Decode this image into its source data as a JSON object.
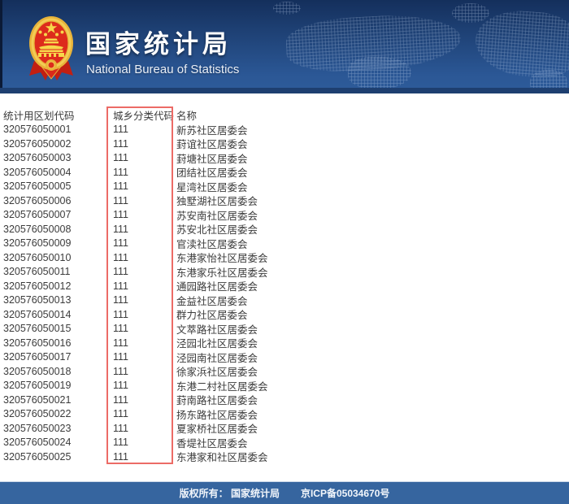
{
  "header": {
    "title": "国家统计局",
    "subtitle": "National Bureau of Statistics"
  },
  "table": {
    "columns": [
      "统计用区划代码",
      "城乡分类代码",
      "名称"
    ],
    "rows": [
      {
        "code": "320576050001",
        "urc": "111",
        "name": "新苏社区居委会"
      },
      {
        "code": "320576050002",
        "urc": "111",
        "name": "葑谊社区居委会"
      },
      {
        "code": "320576050003",
        "urc": "111",
        "name": "葑塘社区居委会"
      },
      {
        "code": "320576050004",
        "urc": "111",
        "name": "团结社区居委会"
      },
      {
        "code": "320576050005",
        "urc": "111",
        "name": "星湾社区居委会"
      },
      {
        "code": "320576050006",
        "urc": "111",
        "name": "独墅湖社区居委会"
      },
      {
        "code": "320576050007",
        "urc": "111",
        "name": "苏安南社区居委会"
      },
      {
        "code": "320576050008",
        "urc": "111",
        "name": "苏安北社区居委会"
      },
      {
        "code": "320576050009",
        "urc": "111",
        "name": "官渎社区居委会"
      },
      {
        "code": "320576050010",
        "urc": "111",
        "name": "东港家怡社区居委会"
      },
      {
        "code": "320576050011",
        "urc": "111",
        "name": "东港家乐社区居委会"
      },
      {
        "code": "320576050012",
        "urc": "111",
        "name": "通园路社区居委会"
      },
      {
        "code": "320576050013",
        "urc": "111",
        "name": "金益社区居委会"
      },
      {
        "code": "320576050014",
        "urc": "111",
        "name": "群力社区居委会"
      },
      {
        "code": "320576050015",
        "urc": "111",
        "name": "文萃路社区居委会"
      },
      {
        "code": "320576050016",
        "urc": "111",
        "name": "泾园北社区居委会"
      },
      {
        "code": "320576050017",
        "urc": "111",
        "name": "泾园南社区居委会"
      },
      {
        "code": "320576050018",
        "urc": "111",
        "name": "徐家浜社区居委会"
      },
      {
        "code": "320576050019",
        "urc": "111",
        "name": "东港二村社区居委会"
      },
      {
        "code": "320576050021",
        "urc": "111",
        "name": "葑南路社区居委会"
      },
      {
        "code": "320576050022",
        "urc": "111",
        "name": "扬东路社区居委会"
      },
      {
        "code": "320576050023",
        "urc": "111",
        "name": "夏家桥社区居委会"
      },
      {
        "code": "320576050024",
        "urc": "111",
        "name": "香堤社区居委会"
      },
      {
        "code": "320576050025",
        "urc": "111",
        "name": "东港家和社区居委会"
      }
    ]
  },
  "footer": {
    "copyright": "版权所有： 国家统计局",
    "icp": "京ICP备05034670号"
  },
  "colors": {
    "header_top": "#142f5c",
    "header_bottom": "#2e5c9b",
    "footer_bar": "#36659f",
    "highlight_border": "#ec6b66",
    "emblem_red": "#dd2b1c",
    "emblem_gold": "#f0c04a",
    "table_text": "#3b3b3b"
  }
}
